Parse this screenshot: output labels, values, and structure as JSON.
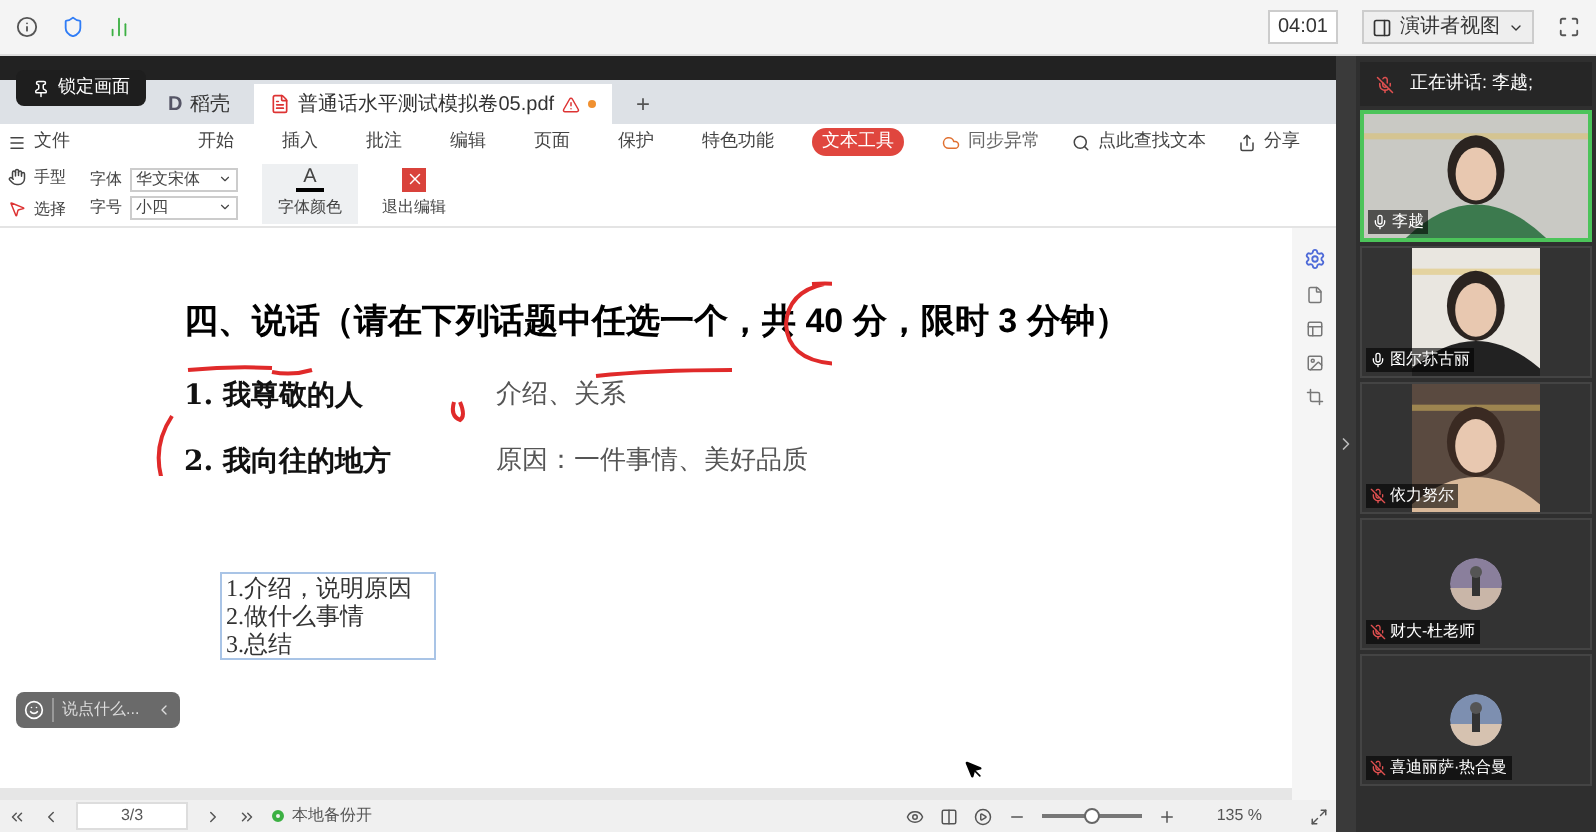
{
  "topbar": {
    "timer": "04:01",
    "view_menu": "演讲者视图"
  },
  "lock_button": "锁定画面",
  "tabs": [
    {
      "label": "稻壳",
      "badge": "D",
      "selected": false
    },
    {
      "label": "普通话水平测试模拟卷05.pdf",
      "selected": true
    }
  ],
  "new_tab": "+",
  "menu": {
    "file": "文件",
    "items": [
      {
        "label": "开始",
        "selected": false
      },
      {
        "label": "插入",
        "selected": false
      },
      {
        "label": "批注",
        "selected": false
      },
      {
        "label": "编辑",
        "selected": false
      },
      {
        "label": "页面",
        "selected": false
      },
      {
        "label": "保护",
        "selected": false
      },
      {
        "label": "特色功能",
        "selected": false
      },
      {
        "label": "文本工具",
        "selected": true
      }
    ],
    "sync": "同步异常",
    "search": "点此查找文本",
    "share": "分享"
  },
  "toolbar": {
    "hand": "手型",
    "select": "选择",
    "font_label": "字体",
    "font": "华文宋体",
    "size_label": "字号",
    "size": "小四",
    "font_color": "字体颜色",
    "font_color_glyph": "A",
    "exit_edit": "退出编辑"
  },
  "document": {
    "heading": "四、说话（请在下列话题中任选一个，共 40 分，限时 3 分钟）",
    "topics": [
      {
        "number": "1.",
        "title": "我尊敬的人",
        "note": "介绍、关系"
      },
      {
        "number": "2.",
        "title": "我向往的地方",
        "note": "原因：一件事情、美好品质"
      }
    ],
    "textbox": [
      "1.介绍，说明原因",
      "2.做什么事情",
      "3.总结"
    ]
  },
  "chat": {
    "placeholder": "说点什么..."
  },
  "status": {
    "page": "3/3",
    "backup": "本地备份开",
    "zoom": "135 %",
    "level": 0.5
  },
  "panel": {
    "speaking": "正在讲话: 李越;",
    "participants": [
      {
        "name": "李越",
        "kind": "video",
        "muted": false,
        "speaking": true
      },
      {
        "name": "图尔荪古丽",
        "kind": "video",
        "muted": false,
        "speaking": false
      },
      {
        "name": "依力努尔",
        "kind": "video",
        "muted": true,
        "speaking": false
      },
      {
        "name": "财大-杜老师",
        "kind": "avatar",
        "muted": true,
        "speaking": false
      },
      {
        "name": "喜迪丽萨·热合曼",
        "kind": "avatar",
        "muted": true,
        "speaking": false
      }
    ]
  }
}
